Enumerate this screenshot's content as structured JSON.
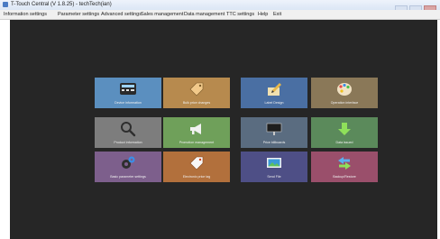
{
  "window": {
    "title": "T-Touch Central (V 1.8.25) - techTech(ian)"
  },
  "menu": [
    "Information settings",
    "Parameter settings",
    "Advanced settings",
    "Sales management",
    "Data management",
    "TTC settings",
    "Help",
    "Exit"
  ],
  "tiles": [
    {
      "label": "Device information",
      "icon": "scale-device-icon",
      "color": "#5b8fbf"
    },
    {
      "label": "Bulk price changes",
      "icon": "price-tag-icon",
      "color": "#b78a4e"
    },
    {
      "label": "Label Design",
      "icon": "label-design-icon",
      "color": "#4a6fa3"
    },
    {
      "label": "Operation interface",
      "icon": "palette-icon",
      "color": "#8a7858"
    },
    {
      "label": "Product information",
      "icon": "magnifier-icon",
      "color": "#7d7d7d"
    },
    {
      "label": "Promotion management",
      "icon": "megaphone-icon",
      "color": "#6fa05a"
    },
    {
      "label": "Price billboards",
      "icon": "billboard-icon",
      "color": "#5a6c80"
    },
    {
      "label": "Data issued",
      "icon": "download-arrow-icon",
      "color": "#5b8a5b"
    },
    {
      "label": "Basic parameter settings",
      "icon": "gears-icon",
      "color": "#7d5f8c"
    },
    {
      "label": "Electronic price tag",
      "icon": "electronic-tag-icon",
      "color": "#b2703c"
    },
    {
      "label": "Send File",
      "icon": "send-file-icon",
      "color": "#4e4f86"
    },
    {
      "label": "Backup/Restore",
      "icon": "backup-restore-icon",
      "color": "#9a4f6b"
    }
  ]
}
